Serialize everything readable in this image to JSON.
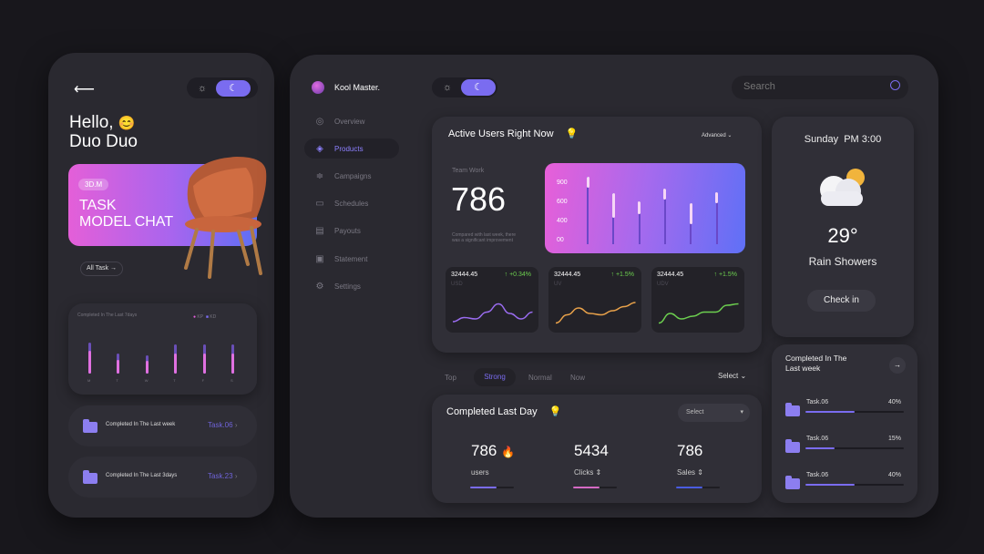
{
  "colors": {
    "accent": "#7a6cf0",
    "pink": "#e85fe0",
    "blue": "#5b6cf5",
    "green": "#6ccf4f",
    "orange": "#e9a24a"
  },
  "phone": {
    "back_icon": "arrow-left-icon",
    "greeting": "Hello,",
    "name": "Duo Duo",
    "emoji": "😊",
    "hero": {
      "badge": "3D.M",
      "title_line1": "TASK",
      "title_line2": "MODEL CHAT",
      "button": "All Task",
      "button_icon": "→"
    },
    "chart": {
      "title": "Completed In The Last 7days",
      "legend": [
        "KP",
        "KD"
      ],
      "values": [
        0.62,
        0.38,
        0.36,
        0.55,
        0.55,
        0.55
      ],
      "caps": [
        0.85,
        0.55,
        0.5,
        0.8,
        0.8,
        0.8
      ],
      "labels": [
        "M",
        "T",
        "W",
        "T",
        "F",
        "S"
      ]
    },
    "list": [
      {
        "label": "Completed In The Last week",
        "task": "Task.06"
      },
      {
        "label": "Completed In The Last 3days",
        "task": "Task.23"
      }
    ]
  },
  "brand": {
    "name": "Kool Master."
  },
  "nav": [
    {
      "label": "Overview",
      "icon": "◎"
    },
    {
      "label": "Products",
      "icon": "◈"
    },
    {
      "label": "Campaigns",
      "icon": "≑"
    },
    {
      "label": "Schedules",
      "icon": "▭"
    },
    {
      "label": "Payouts",
      "icon": "▤"
    },
    {
      "label": "Statement",
      "icon": "▣"
    },
    {
      "label": "Settings",
      "icon": "⚙"
    }
  ],
  "search": {
    "placeholder": "Search"
  },
  "active_users": {
    "title": "Active Users Right Now",
    "filter": "Advanced",
    "team_label": "Team Work",
    "value": "786",
    "note": "Compared with last week, there was a significant improvement",
    "y_ticks": [
      "900",
      "600",
      "400",
      "00"
    ],
    "bars": [
      {
        "top": 0.95,
        "seg": 0.15
      },
      {
        "top": 0.72,
        "seg": 0.35
      },
      {
        "top": 0.6,
        "seg": 0.18
      },
      {
        "top": 0.78,
        "seg": 0.15
      },
      {
        "top": 0.58,
        "seg": 0.3
      },
      {
        "top": 0.73,
        "seg": 0.15
      }
    ]
  },
  "mini_cards": [
    {
      "value": "32444.45",
      "change": "+0.34%",
      "label": "USD",
      "color": "#9a6cf0",
      "points": [
        0.2,
        0.35,
        0.3,
        0.55,
        0.85,
        0.5,
        0.3,
        0.55
      ]
    },
    {
      "value": "32444.45",
      "change": "+1.5%",
      "label": "UV",
      "color": "#e9a24a",
      "points": [
        0.15,
        0.45,
        0.7,
        0.5,
        0.45,
        0.6,
        0.75,
        0.9
      ]
    },
    {
      "value": "32444.45",
      "change": "+1.5%",
      "label": "UDV",
      "color": "#6ccf4f",
      "points": [
        0.15,
        0.5,
        0.3,
        0.4,
        0.55,
        0.55,
        0.8,
        0.85
      ]
    }
  ],
  "weather": {
    "datetime": "Sunday  PM 3:00",
    "temp": "29°",
    "condition": "Rain Showers",
    "button": "Check in"
  },
  "tabs": {
    "items": [
      "Top",
      "Strong",
      "Normal",
      "Now"
    ],
    "active": "Strong",
    "select": "Select"
  },
  "completed_day": {
    "title": "Completed Last Day",
    "select": "Select",
    "stats": [
      {
        "value": "786",
        "label": "users",
        "emoji": "🔥",
        "progress": 0.6,
        "color": "#7a6cf0"
      },
      {
        "value": "5434",
        "label": "Clicks ⇕",
        "progress": 0.6,
        "color": "#d56ac4"
      },
      {
        "value": "786",
        "label": "Sales ⇕",
        "progress": 0.6,
        "color": "#4a5ce0"
      }
    ]
  },
  "completed_week": {
    "title_line1": "Completed In The",
    "title_line2": "Last week",
    "arrow": "→",
    "tasks": [
      {
        "name": "Task.06",
        "percent": "40%",
        "value": 0.5
      },
      {
        "name": "Task.06",
        "percent": "15%",
        "value": 0.3
      },
      {
        "name": "Task.06",
        "percent": "40%",
        "value": 0.5
      }
    ]
  }
}
